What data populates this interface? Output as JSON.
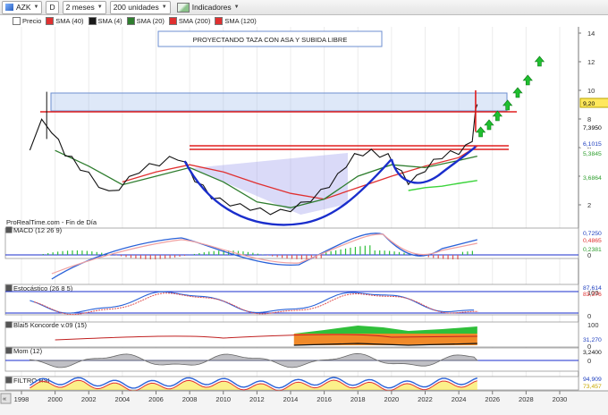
{
  "toolbar": {
    "ticker": "AZK",
    "d_button": "D",
    "period": "2 meses",
    "units": "200 unidades",
    "indicators": "Indicadores"
  },
  "legend": {
    "items": [
      {
        "label": "Precio",
        "color": "#ffffff"
      },
      {
        "label": "SMA (40)",
        "color": "#e03030"
      },
      {
        "label": "SMA (4)",
        "color": "#1a1a1a"
      },
      {
        "label": "SMA (20)",
        "color": "#2e7d2e"
      },
      {
        "label": "SMA (200)",
        "color": "#e03030"
      },
      {
        "label": "SMA (120)",
        "color": "#e03030"
      }
    ]
  },
  "annotation": "PROYECTANDO TAZA CON ASA Y SUBIDA LIBRE",
  "source": "ProRealTime.com - Fin de Día",
  "panels": {
    "macd": "MACD (12 26 9)",
    "stoch": "Estocástico (26 8 5)",
    "blai": "Blai5 Koncorde v.09 (15)",
    "mom": "Mom (12)",
    "rsi": "FILTRO RSI"
  },
  "price_axis": {
    "ticks": [
      "14",
      "12",
      "10",
      "8",
      "6",
      "4",
      "2"
    ],
    "labels": [
      {
        "text": "9,20",
        "bg": "#ffe85c",
        "color": "#000000"
      },
      {
        "text": "7,3950",
        "bg": "#ffffff",
        "color": "#000000"
      },
      {
        "text": "6,1015",
        "bg": "#ffffff",
        "color": "#1f3fbf"
      },
      {
        "text": "5,3845",
        "bg": "#ffffff",
        "color": "#2e9e2e"
      },
      {
        "text": "3,6864",
        "bg": "#ffffff",
        "color": "#2e9e2e"
      }
    ]
  },
  "macd_axis": {
    "ticks": [
      "0"
    ],
    "labels": [
      "0,7250",
      "0,4865",
      "0,2381"
    ]
  },
  "stoch_axis": {
    "ticks": [
      "100",
      "0"
    ],
    "labels": [
      "87,614",
      "83,376"
    ]
  },
  "blai_axis": {
    "ticks": [
      "100",
      "0"
    ],
    "labels": [
      "31,270"
    ]
  },
  "mom_axis": {
    "ticks": [
      "0"
    ],
    "labels": [
      "3,2400"
    ]
  },
  "rsi_axis": {
    "labels": [
      "94,909",
      "73,457"
    ]
  },
  "x_axis": {
    "ticks": [
      "1998",
      "2000",
      "2002",
      "2004",
      "2006",
      "2008",
      "2010",
      "2012",
      "2014",
      "2016",
      "2018",
      "2020",
      "2022",
      "2024",
      "2026",
      "2028",
      "2030"
    ]
  },
  "chart_data": {
    "type": "line",
    "title": "PROYECTANDO TAZA CON ASA Y SUBIDA LIBRE",
    "x_range": [
      1998,
      2030
    ],
    "ylim": [
      0,
      15
    ],
    "series": [
      {
        "name": "Precio",
        "x": [
          1998.5,
          1999.2,
          1999.8,
          2000.2,
          2000.6,
          2001.0,
          2001.5,
          2002.0,
          2002.6,
          2003.2,
          2003.8,
          2004.4,
          2005.0,
          2005.6,
          2006.2,
          2006.8,
          2007.3,
          2007.8,
          2008.3,
          2008.8,
          2009.3,
          2009.8,
          2010.4,
          2011.0,
          2011.6,
          2012.2,
          2012.8,
          2013.4,
          2014.0,
          2014.6,
          2015.2,
          2015.8,
          2016.3,
          2016.8,
          2017.3,
          2017.8,
          2018.3,
          2018.8,
          2019.3,
          2019.8,
          2020.2,
          2020.6,
          2021.0,
          2021.5,
          2022.0,
          2022.5,
          2023.0,
          2023.5,
          2024.0,
          2024.4,
          2024.8,
          2025.0,
          2025.1
        ],
        "values": [
          6.0,
          7.8,
          7.2,
          6.4,
          5.6,
          5.2,
          4.6,
          4.1,
          3.4,
          2.8,
          3.2,
          3.8,
          4.4,
          4.7,
          4.9,
          5.2,
          5.3,
          4.8,
          3.8,
          3.2,
          2.6,
          2.3,
          2.1,
          1.9,
          1.8,
          1.6,
          1.5,
          1.5,
          1.7,
          2.0,
          2.4,
          2.9,
          3.4,
          4.0,
          4.8,
          5.4,
          5.6,
          5.7,
          5.5,
          5.4,
          4.8,
          4.2,
          3.6,
          3.9,
          4.5,
          5.0,
          5.4,
          5.6,
          5.7,
          6.0,
          6.6,
          8.5,
          9.2
        ]
      },
      {
        "name": "SMA (40)",
        "x": [
          2004.0,
          2006.0,
          2008.0,
          2010.0,
          2012.0,
          2014.0,
          2016.0,
          2018.0,
          2020.0,
          2022.0,
          2024.0,
          2025.1
        ],
        "values": [
          3.6,
          4.3,
          4.8,
          4.3,
          3.5,
          2.8,
          2.4,
          3.2,
          4.0,
          4.7,
          5.3,
          6.1
        ]
      },
      {
        "name": "SMA (20)",
        "x": [
          2000.0,
          2002.0,
          2004.0,
          2006.0,
          2008.0,
          2010.0,
          2012.0,
          2014.0,
          2016.0,
          2018.0,
          2020.0,
          2022.0,
          2024.0,
          2025.1
        ],
        "values": [
          5.8,
          4.7,
          3.4,
          4.0,
          4.6,
          3.6,
          2.2,
          1.8,
          2.4,
          4.0,
          4.8,
          4.6,
          5.1,
          5.4
        ]
      },
      {
        "name": "SMA (120)",
        "x": [
          2021.0,
          2022.0,
          2023.0,
          2024.0,
          2025.1
        ],
        "values": [
          3.0,
          3.2,
          3.3,
          3.5,
          3.7
        ]
      }
    ]
  }
}
